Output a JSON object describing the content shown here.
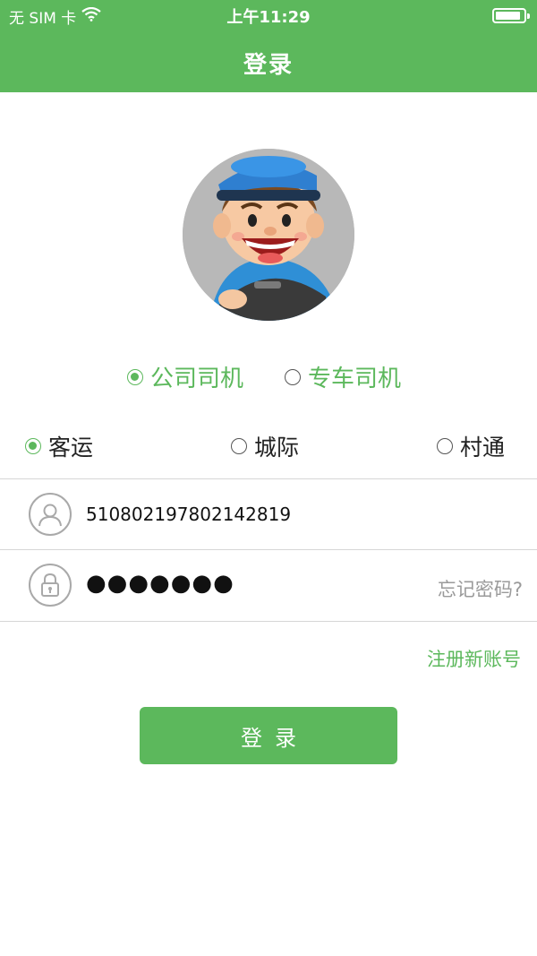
{
  "status_bar": {
    "carrier": "无 SIM 卡",
    "time": "上午11:29",
    "battery_level": 0.9
  },
  "header": {
    "title": "登录"
  },
  "avatar": {
    "icon": "driver-avatar"
  },
  "driver_type": {
    "options": [
      {
        "label": "公司司机",
        "selected": true
      },
      {
        "label": "专车司机",
        "selected": false
      }
    ]
  },
  "service_type": {
    "options": [
      {
        "label": "客运",
        "selected": true
      },
      {
        "label": "城际",
        "selected": false
      },
      {
        "label": "村通",
        "selected": false
      }
    ]
  },
  "account": {
    "value": "510802197802142819",
    "icon": "user-icon"
  },
  "password": {
    "value": "●●●●●●●",
    "icon": "lock-icon",
    "forgot_label": "忘记密码?"
  },
  "register_label": "注册新账号",
  "login_button": "登录",
  "colors": {
    "primary": "#5cb85c",
    "divider": "#d6d6d6",
    "hint": "#9a9a9a"
  }
}
